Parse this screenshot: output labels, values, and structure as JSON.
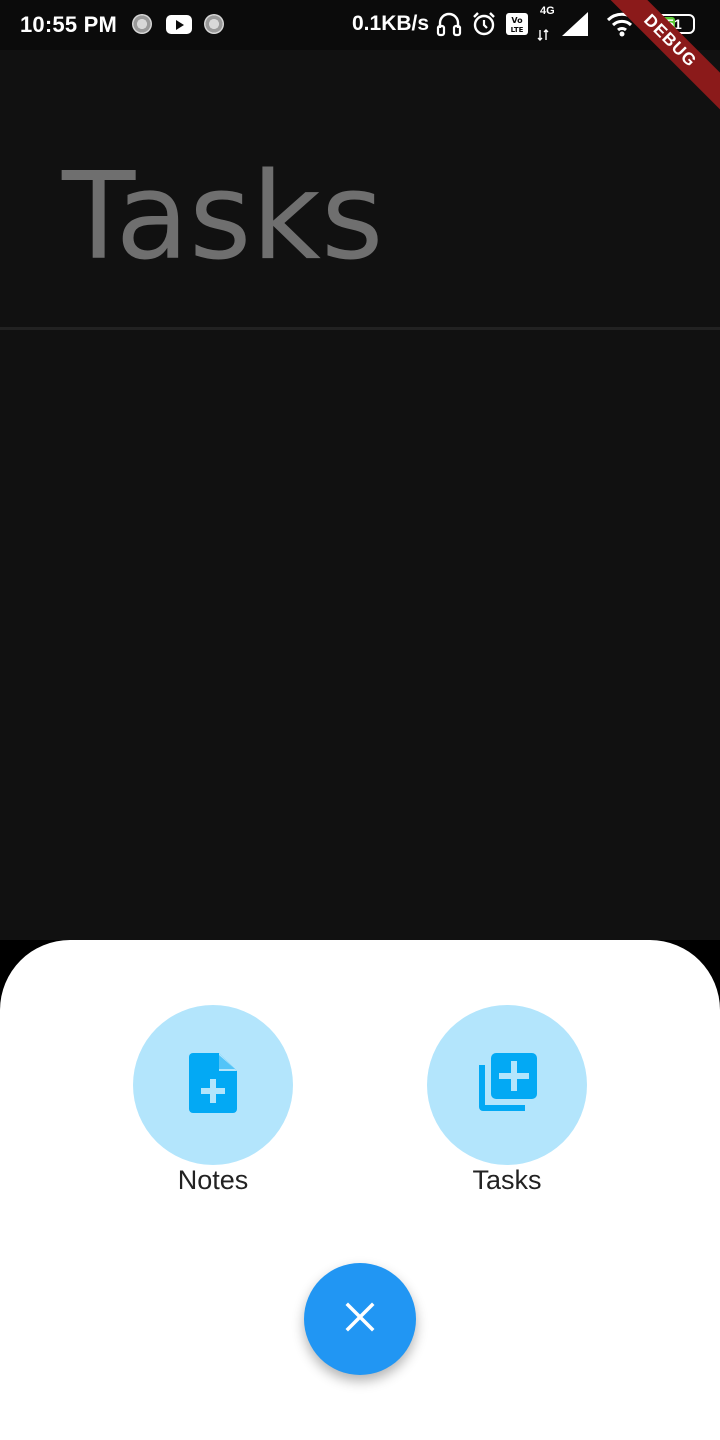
{
  "status_bar": {
    "time": "10:55 PM",
    "net_speed": "0.1KB/s",
    "network_type": "4G",
    "battery_level": "51",
    "battery_fraction": 0.51
  },
  "debug_banner": {
    "label": "DEBUG"
  },
  "header": {
    "title": "Tasks"
  },
  "sheet": {
    "actions": [
      {
        "label": "Notes",
        "icon": "note-add-icon"
      },
      {
        "label": "Tasks",
        "icon": "library-add-icon"
      }
    ],
    "close_icon": "close-icon"
  },
  "colors": {
    "background": "#111111",
    "title": "#6f6f6f",
    "action_circle": "#b3e5fc",
    "action_icon": "#03a9f4",
    "fab": "#2196f3",
    "debug_ribbon": "#8b1a1a",
    "battery": "#5ccc36"
  }
}
